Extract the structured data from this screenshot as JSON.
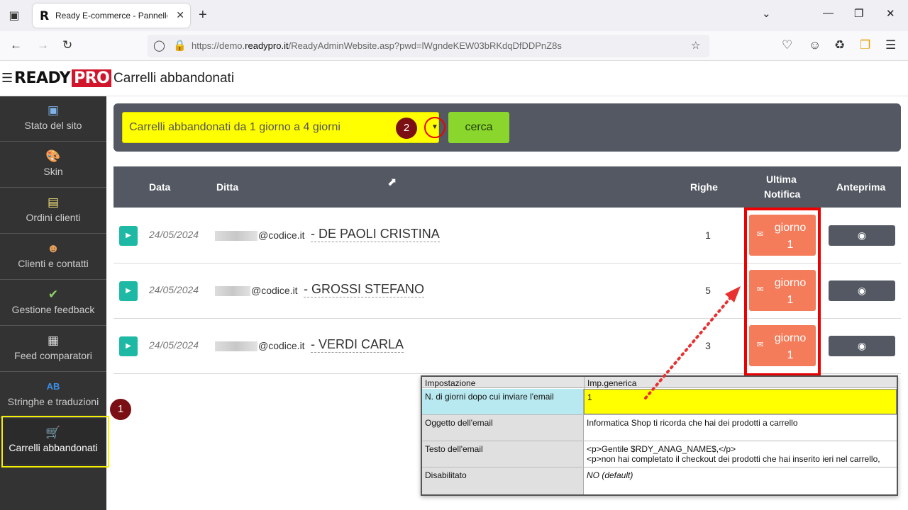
{
  "browser": {
    "tab_title": "Ready E-commerce - Pannello",
    "url_prefix": "https://demo.",
    "url_domain": "readypro.it",
    "url_path": "/ReadyAdminWebsite.asp?pwd=lWgndeKEW03bRKdqDfDDPnZ8s"
  },
  "header": {
    "logo_ready": "READY",
    "logo_pro": "PRO",
    "page_title": "Carrelli abbandonati"
  },
  "sidebar": {
    "items": [
      {
        "label": "Stato del sito",
        "icon": "site-status-icon"
      },
      {
        "label": "Skin",
        "icon": "palette-icon"
      },
      {
        "label": "Ordini clienti",
        "icon": "orders-icon"
      },
      {
        "label": "Clienti e contatti",
        "icon": "contacts-icon"
      },
      {
        "label": "Gestione feedback",
        "icon": "feedback-icon"
      },
      {
        "label": "Feed comparatori",
        "icon": "grid-icon"
      },
      {
        "label": "Stringhe e traduzioni",
        "icon": "translate-icon"
      },
      {
        "label": "Carrelli abbandonati",
        "icon": "cart-icon"
      }
    ]
  },
  "badges": {
    "one": "1",
    "two": "2"
  },
  "filter": {
    "selected": "Carrelli abbandonati da 1 giorno a 4 giorni",
    "search_label": "cerca"
  },
  "table": {
    "headers": {
      "data": "Data",
      "ditta": "Ditta",
      "righe": "Righe",
      "ultima": "Ultima",
      "notifica": "Notifica",
      "anteprima": "Anteprima"
    },
    "rows": [
      {
        "date": "24/05/2024",
        "email_domain": "@codice.it",
        "name": "- DE PAOLI CRISTINA",
        "righe": "1",
        "notif_word": "giorno",
        "notif_num": "1"
      },
      {
        "date": "24/05/2024",
        "email_domain": "@codice.it",
        "name": "- GROSSI STEFANO",
        "righe": "5",
        "notif_word": "giorno",
        "notif_num": "1"
      },
      {
        "date": "24/05/2024",
        "email_domain": "@codice.it",
        "name": "- VERDI CARLA",
        "righe": "3",
        "notif_word": "giorno",
        "notif_num": "1"
      }
    ]
  },
  "settings": {
    "col_impostazione": "Impostazione",
    "col_generica": "Imp.generica",
    "rows": [
      {
        "label": "N. di giorni dopo cui inviare l'email",
        "value": "1",
        "value2": ""
      },
      {
        "label": "Oggetto dell'email",
        "value": "Informatica Shop ti ricorda che hai dei prodotti a carrello",
        "value2": ""
      },
      {
        "label": "Testo dell'email",
        "value": "<p>Gentile $RDY_ANAG_NAME$,</p>",
        "value2": "<p>non hai completato il checkout dei prodotti che hai inserito ieri nel carrello,"
      },
      {
        "label": "Disabilitato",
        "value": "NO (default)",
        "value2": ""
      }
    ]
  },
  "colors": {
    "accent_green": "#8ad62c",
    "notif_orange": "#f57c5a",
    "teal": "#1db9a4",
    "panel": "#535862"
  }
}
